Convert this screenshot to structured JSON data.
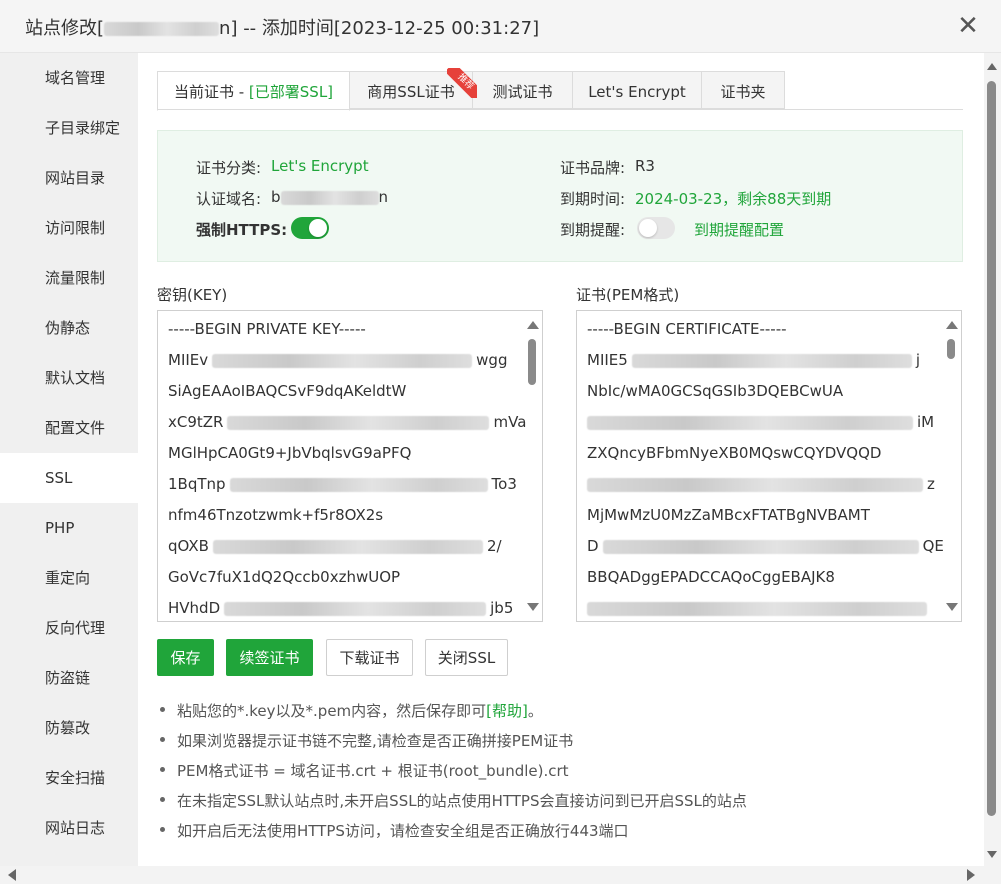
{
  "title": {
    "prefix": "站点修改[",
    "suffix_visible": "n]",
    "added_time": " -- 添加时间[2023-12-25 00:31:27]"
  },
  "sidebar": {
    "items": [
      {
        "label": "域名管理"
      },
      {
        "label": "子目录绑定"
      },
      {
        "label": "网站目录"
      },
      {
        "label": "访问限制"
      },
      {
        "label": "流量限制"
      },
      {
        "label": "伪静态"
      },
      {
        "label": "默认文档"
      },
      {
        "label": "配置文件"
      },
      {
        "label": "SSL",
        "active": true
      },
      {
        "label": "PHP"
      },
      {
        "label": "重定向"
      },
      {
        "label": "反向代理"
      },
      {
        "label": "防盗链"
      },
      {
        "label": "防篡改"
      },
      {
        "label": "安全扫描"
      },
      {
        "label": "网站日志"
      }
    ]
  },
  "tabs": {
    "current_prefix": "当前证书 - ",
    "current_status": "[已部署SSL]",
    "commercial": "商用SSL证书",
    "ribbon": "推荐",
    "test": "测试证书",
    "letsencrypt": "Let's Encrypt",
    "folder": "证书夹"
  },
  "info": {
    "category_label": "证书分类:",
    "category_value": "Let's Encrypt",
    "brand_label": "证书品牌:",
    "brand_value": "R3",
    "domain_label": "认证域名:",
    "domain_visible_start": "b",
    "domain_visible_end": "n",
    "expire_label": "到期时间:",
    "expire_value": "2024-03-23，剩余88天到期",
    "https_label": "强制HTTPS:",
    "https_on": true,
    "remind_label": "到期提醒:",
    "remind_on": false,
    "remind_link": "到期提醒配置"
  },
  "key_area": {
    "label": "密钥(KEY)",
    "lines": [
      "-----BEGIN PRIVATE KEY-----",
      "MIIEv",
      "SiAgEAAoIBAQCSvF9dqAKeldtW",
      "xC9tZR",
      "MGlHpCA0Gt9+JbVbqlsvG9aPFQ",
      "1BqTnp",
      "nfm46Tnzotzwmk+f5r8OX2s",
      "qOXB",
      "GoVc7fuX1dQ2Qccb0xzhwUOP",
      "HVhdD"
    ],
    "tails": {
      "1": "wgg",
      "3": "mVa",
      "5": "To3",
      "7": "2/",
      "9": "jb5"
    }
  },
  "cert_area": {
    "label": "证书(PEM格式)",
    "lines": [
      "-----BEGIN CERTIFICATE-----",
      "MIIE5",
      "NbIc/wMA0GCSqGSIb3DQEBCwUA",
      "",
      "ZXQncyBFbmNyeXB0MQswCQYDVQQD",
      "",
      "MjMwMzU0MzZaMBcxFTATBgNVBAMT",
      "D",
      "BBQADggEPADCCAQoCggEBAJK8",
      ""
    ],
    "tails": {
      "1": "j",
      "3": "iM",
      "5": "z",
      "7": "QE",
      "9": ""
    }
  },
  "buttons": {
    "save": "保存",
    "renew": "续签证书",
    "download": "下载证书",
    "close_ssl": "关闭SSL"
  },
  "tips": {
    "t1_prefix": "粘贴您的*.key以及*.pem内容，然后保存即可",
    "t1_link": "[帮助]",
    "t1_suffix": "。",
    "t2": "如果浏览器提示证书链不完整,请检查是否正确拼接PEM证书",
    "t3": "PEM格式证书 = 域名证书.crt + 根证书(root_bundle).crt",
    "t4": "在未指定SSL默认站点时,未开启SSL的站点使用HTTPS会直接访问到已开启SSL的站点",
    "t5": "如开启后无法使用HTTPS访问，请检查安全组是否正确放行443端口"
  },
  "colors": {
    "accent": "#20a53a",
    "info_bg": "#f1f9f3",
    "ribbon": "#e6413a"
  }
}
